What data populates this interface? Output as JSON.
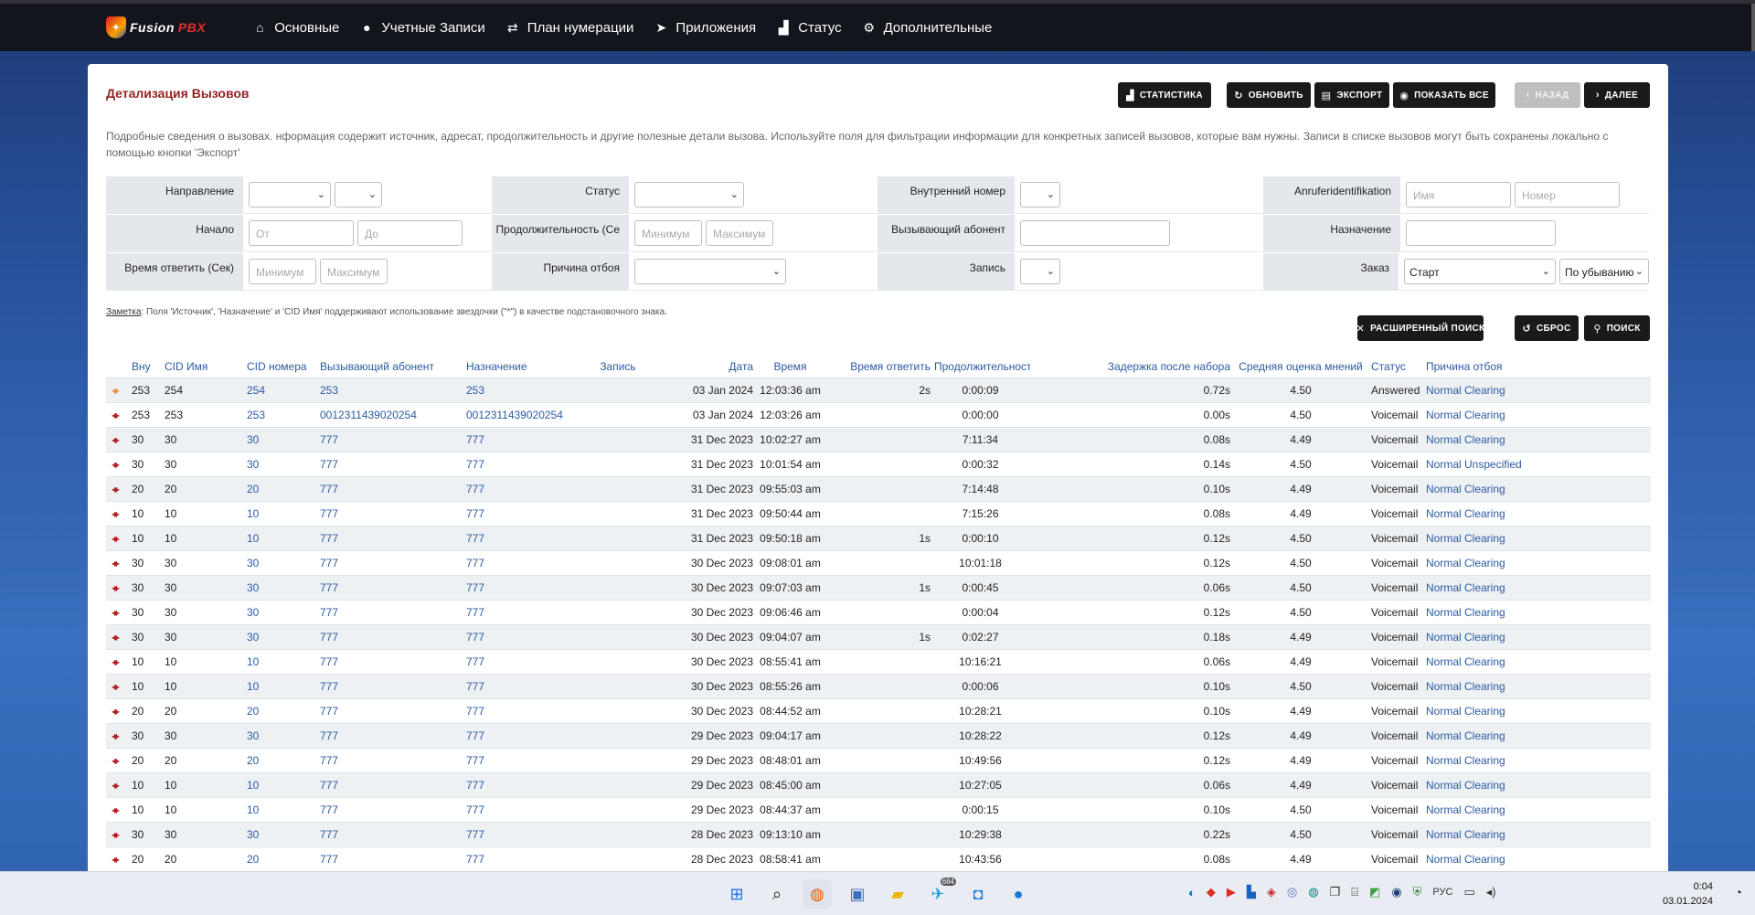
{
  "nav": {
    "logo_text": "Fusion",
    "logo_pbx": "PBX",
    "items": [
      {
        "label": "Основные",
        "icon": "home-icon"
      },
      {
        "label": "Учетные Записи",
        "icon": "user-icon"
      },
      {
        "label": "План нумерации",
        "icon": "exchange-icon"
      },
      {
        "label": "Приложения",
        "icon": "paper-plane-icon"
      },
      {
        "label": "Статус",
        "icon": "bar-chart-icon"
      },
      {
        "label": "Дополнительные",
        "icon": "gear-icon"
      }
    ]
  },
  "page": {
    "title": "Детализация Вызовов",
    "description": "Подробные сведения о вызовах. нформация содержит источник, адресат, продолжительность и другие полезные детали вызова. Используйте поля для фильтрации информации для конкретных записей вызовов, которые вам нужны. Записи в списке вызовов могут быть сохранены локально с помощью кнопки 'Экспорт'",
    "note_label": "Заметка",
    "note_text": ": Поля 'Источник', 'Назначение' и 'CID Имя' поддерживают использование звездочки (\"*\") в качестве подстановочного знака."
  },
  "buttons": {
    "statistics": "Статистика",
    "refresh": "Обновить",
    "export": "Экспорт",
    "show_all": "Показать все",
    "back": "Назад",
    "next": "Далее",
    "advanced_search": "Расширенный поиск",
    "reset": "Сброс",
    "search": "Поиск"
  },
  "filters": {
    "direction_label": "Направление",
    "status_label": "Статус",
    "extension_label": "Внутренний номер",
    "caller_id_label": "Anruferidentifikation",
    "caller_name_placeholder": "Имя",
    "caller_number_placeholder": "Номер",
    "start_label": "Начало",
    "start_from_placeholder": "От",
    "start_to_placeholder": "До",
    "duration_label": "Продолжительность (Се",
    "duration_min_placeholder": "Минимум",
    "duration_max_placeholder": "Максимум",
    "caller_label": "Вызывающий абонент",
    "destination_label": "Назначение",
    "answer_time_label": "Время ответить (Сек)",
    "answer_min_placeholder": "Минимум",
    "answer_max_placeholder": "Максимум",
    "hangup_cause_label": "Причина отбоя",
    "recording_label": "Запись",
    "order_label": "Заказ",
    "order_by_value": "Старт",
    "order_dir_value": "По убыванию"
  },
  "table": {
    "headers": [
      "Вну",
      "CID Имя",
      "CID номера",
      "Вызывающий абонент",
      "Назначение",
      "Запись",
      "Дата",
      "Время",
      "Время ответить",
      "Продолжительность",
      "Задержка после набора",
      "Средняя оценка мнений",
      "Статус",
      "Причина отбоя"
    ],
    "rows": [
      {
        "dir": "in",
        "ext": "253",
        "cid_name": "254",
        "cid_num": "254",
        "caller": "253",
        "dest": "253",
        "rec": "",
        "date": "03 Jan 2024",
        "time": "12:03:36 am",
        "answer": "2s",
        "dur": "0:00:09",
        "pdd": "0.72s",
        "mos": "4.50",
        "status": "Answered",
        "cause": "Normal Clearing"
      },
      {
        "dir": "out",
        "ext": "253",
        "cid_name": "253",
        "cid_num": "253",
        "caller": "0012311439020254",
        "dest": "0012311439020254",
        "rec": "",
        "date": "03 Jan 2024",
        "time": "12:03:26 am",
        "answer": "",
        "dur": "0:00:00",
        "pdd": "0.00s",
        "mos": "4.50",
        "status": "Voicemail",
        "cause": "Normal Clearing"
      },
      {
        "dir": "out",
        "ext": "30",
        "cid_name": "30",
        "cid_num": "30",
        "caller": "777",
        "dest": "777",
        "rec": "",
        "date": "31 Dec 2023",
        "time": "10:02:27 am",
        "answer": "",
        "dur": "7:11:34",
        "pdd": "0.08s",
        "mos": "4.49",
        "status": "Voicemail",
        "cause": "Normal Clearing"
      },
      {
        "dir": "out",
        "ext": "30",
        "cid_name": "30",
        "cid_num": "30",
        "caller": "777",
        "dest": "777",
        "rec": "",
        "date": "31 Dec 2023",
        "time": "10:01:54 am",
        "answer": "",
        "dur": "0:00:32",
        "pdd": "0.14s",
        "mos": "4.50",
        "status": "Voicemail",
        "cause": "Normal Unspecified"
      },
      {
        "dir": "out",
        "ext": "20",
        "cid_name": "20",
        "cid_num": "20",
        "caller": "777",
        "dest": "777",
        "rec": "",
        "date": "31 Dec 2023",
        "time": "09:55:03 am",
        "answer": "",
        "dur": "7:14:48",
        "pdd": "0.10s",
        "mos": "4.49",
        "status": "Voicemail",
        "cause": "Normal Clearing"
      },
      {
        "dir": "out",
        "ext": "10",
        "cid_name": "10",
        "cid_num": "10",
        "caller": "777",
        "dest": "777",
        "rec": "",
        "date": "31 Dec 2023",
        "time": "09:50:44 am",
        "answer": "",
        "dur": "7:15:26",
        "pdd": "0.08s",
        "mos": "4.49",
        "status": "Voicemail",
        "cause": "Normal Clearing"
      },
      {
        "dir": "out",
        "ext": "10",
        "cid_name": "10",
        "cid_num": "10",
        "caller": "777",
        "dest": "777",
        "rec": "",
        "date": "31 Dec 2023",
        "time": "09:50:18 am",
        "answer": "1s",
        "dur": "0:00:10",
        "pdd": "0.12s",
        "mos": "4.50",
        "status": "Voicemail",
        "cause": "Normal Clearing"
      },
      {
        "dir": "out",
        "ext": "30",
        "cid_name": "30",
        "cid_num": "30",
        "caller": "777",
        "dest": "777",
        "rec": "",
        "date": "30 Dec 2023",
        "time": "09:08:01 am",
        "answer": "",
        "dur": "10:01:18",
        "pdd": "0.12s",
        "mos": "4.50",
        "status": "Voicemail",
        "cause": "Normal Clearing"
      },
      {
        "dir": "out",
        "ext": "30",
        "cid_name": "30",
        "cid_num": "30",
        "caller": "777",
        "dest": "777",
        "rec": "",
        "date": "30 Dec 2023",
        "time": "09:07:03 am",
        "answer": "1s",
        "dur": "0:00:45",
        "pdd": "0.06s",
        "mos": "4.50",
        "status": "Voicemail",
        "cause": "Normal Clearing"
      },
      {
        "dir": "out",
        "ext": "30",
        "cid_name": "30",
        "cid_num": "30",
        "caller": "777",
        "dest": "777",
        "rec": "",
        "date": "30 Dec 2023",
        "time": "09:06:46 am",
        "answer": "",
        "dur": "0:00:04",
        "pdd": "0.12s",
        "mos": "4.50",
        "status": "Voicemail",
        "cause": "Normal Clearing"
      },
      {
        "dir": "out",
        "ext": "30",
        "cid_name": "30",
        "cid_num": "30",
        "caller": "777",
        "dest": "777",
        "rec": "",
        "date": "30 Dec 2023",
        "time": "09:04:07 am",
        "answer": "1s",
        "dur": "0:02:27",
        "pdd": "0.18s",
        "mos": "4.49",
        "status": "Voicemail",
        "cause": "Normal Clearing"
      },
      {
        "dir": "out",
        "ext": "10",
        "cid_name": "10",
        "cid_num": "10",
        "caller": "777",
        "dest": "777",
        "rec": "",
        "date": "30 Dec 2023",
        "time": "08:55:41 am",
        "answer": "",
        "dur": "10:16:21",
        "pdd": "0.06s",
        "mos": "4.49",
        "status": "Voicemail",
        "cause": "Normal Clearing"
      },
      {
        "dir": "out",
        "ext": "10",
        "cid_name": "10",
        "cid_num": "10",
        "caller": "777",
        "dest": "777",
        "rec": "",
        "date": "30 Dec 2023",
        "time": "08:55:26 am",
        "answer": "",
        "dur": "0:00:06",
        "pdd": "0.10s",
        "mos": "4.50",
        "status": "Voicemail",
        "cause": "Normal Clearing"
      },
      {
        "dir": "out",
        "ext": "20",
        "cid_name": "20",
        "cid_num": "20",
        "caller": "777",
        "dest": "777",
        "rec": "",
        "date": "30 Dec 2023",
        "time": "08:44:52 am",
        "answer": "",
        "dur": "10:28:21",
        "pdd": "0.10s",
        "mos": "4.49",
        "status": "Voicemail",
        "cause": "Normal Clearing"
      },
      {
        "dir": "out",
        "ext": "30",
        "cid_name": "30",
        "cid_num": "30",
        "caller": "777",
        "dest": "777",
        "rec": "",
        "date": "29 Dec 2023",
        "time": "09:04:17 am",
        "answer": "",
        "dur": "10:28:22",
        "pdd": "0.12s",
        "mos": "4.49",
        "status": "Voicemail",
        "cause": "Normal Clearing"
      },
      {
        "dir": "out",
        "ext": "20",
        "cid_name": "20",
        "cid_num": "20",
        "caller": "777",
        "dest": "777",
        "rec": "",
        "date": "29 Dec 2023",
        "time": "08:48:01 am",
        "answer": "",
        "dur": "10:49:56",
        "pdd": "0.12s",
        "mos": "4.49",
        "status": "Voicemail",
        "cause": "Normal Clearing"
      },
      {
        "dir": "out",
        "ext": "10",
        "cid_name": "10",
        "cid_num": "10",
        "caller": "777",
        "dest": "777",
        "rec": "",
        "date": "29 Dec 2023",
        "time": "08:45:00 am",
        "answer": "",
        "dur": "10:27:05",
        "pdd": "0.06s",
        "mos": "4.49",
        "status": "Voicemail",
        "cause": "Normal Clearing"
      },
      {
        "dir": "out",
        "ext": "10",
        "cid_name": "10",
        "cid_num": "10",
        "caller": "777",
        "dest": "777",
        "rec": "",
        "date": "29 Dec 2023",
        "time": "08:44:37 am",
        "answer": "",
        "dur": "0:00:15",
        "pdd": "0.10s",
        "mos": "4.50",
        "status": "Voicemail",
        "cause": "Normal Clearing"
      },
      {
        "dir": "out",
        "ext": "30",
        "cid_name": "30",
        "cid_num": "30",
        "caller": "777",
        "dest": "777",
        "rec": "",
        "date": "28 Dec 2023",
        "time": "09:13:10 am",
        "answer": "",
        "dur": "10:29:38",
        "pdd": "0.22s",
        "mos": "4.50",
        "status": "Voicemail",
        "cause": "Normal Clearing"
      },
      {
        "dir": "out",
        "ext": "20",
        "cid_name": "20",
        "cid_num": "20",
        "caller": "777",
        "dest": "777",
        "rec": "",
        "date": "28 Dec 2023",
        "time": "08:58:41 am",
        "answer": "",
        "dur": "10:43:56",
        "pdd": "0.08s",
        "mos": "4.49",
        "status": "Voicemail",
        "cause": "Normal Clearing"
      }
    ]
  },
  "taskbar": {
    "language": "РУС",
    "time": "0:04",
    "date": "03.01.2024",
    "telegram_badge": "684"
  },
  "colors": {
    "navbar": "#12151c",
    "title": "#952424",
    "link": "#2b5aa0",
    "label_bg": "#e4e8ed",
    "outbound_arrow": "#b22222",
    "inbound_arrow": "#e39346"
  }
}
